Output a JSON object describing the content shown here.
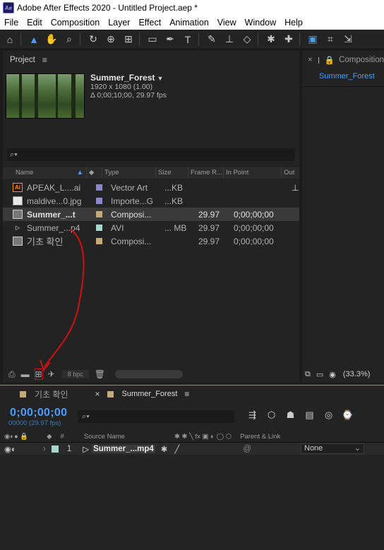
{
  "window": {
    "title": "Adobe After Effects 2020 - Untitled Project.aep *",
    "logo": "Ae"
  },
  "menu": [
    "File",
    "Edit",
    "Composition",
    "Layer",
    "Effect",
    "Animation",
    "View",
    "Window",
    "Help"
  ],
  "project_panel": {
    "tab_label": "Project",
    "selected_item": {
      "name": "Summer_Forest",
      "dims": "1920 x 1080 (1.00)",
      "duration": "Δ 0;00;10;00, 29.97 fps"
    },
    "search_placeholder": "⌕▾",
    "columns": [
      "Name",
      "Type",
      "Size",
      "Frame R...",
      "In Point",
      "Out"
    ],
    "rows": [
      {
        "name": "APEAK_L....ai",
        "type": "Vector Art",
        "size": "...KB",
        "fps": "",
        "inpoint": "",
        "swatch": "#8a8ac8",
        "icon": "ai-icon"
      },
      {
        "name": "maldive...0.jpg",
        "type": "Importe...G",
        "size": "...KB",
        "fps": "",
        "inpoint": "",
        "swatch": "#8a8ac8",
        "icon": "jpg-icon"
      },
      {
        "name": "Summer_...t",
        "type": "Composi...",
        "size": "",
        "fps": "29.97",
        "inpoint": "0;00;00;00",
        "swatch": "#c4a97a",
        "icon": "composition-icon"
      },
      {
        "name": "Summer_...p4",
        "type": "AVI",
        "size": "... MB",
        "fps": "29.97",
        "inpoint": "0;00;00;00",
        "swatch": "#a6d6d0",
        "icon": "avi-icon"
      },
      {
        "name": "기초 확인",
        "type": "Composi...",
        "size": "",
        "fps": "29.97",
        "inpoint": "0;00;00;00",
        "swatch": "#c4a97a",
        "icon": "composition-icon"
      }
    ],
    "bpc": "8 bpc"
  },
  "composition_panel": {
    "tab_label": "Composition",
    "comp_name": "Summer_Forest",
    "zoom": "(33.3%)"
  },
  "timeline": {
    "tabs": [
      {
        "label": "기초 확인"
      },
      {
        "label": "Summer_Forest"
      }
    ],
    "timecode": "0;00;00;00",
    "frame_info": "00000 (29.97 fps)",
    "search_placeholder": "⌕▾",
    "columns": {
      "source": "Source Name",
      "parent": "Parent & Link",
      "num": "#"
    },
    "layer": {
      "index": "1",
      "name": "Summer_...mp4",
      "parent": "None",
      "swatch": "#a6d6d0"
    }
  },
  "colors": {
    "accent": "#4a9df8",
    "annotation_arrow": "#d01010"
  }
}
